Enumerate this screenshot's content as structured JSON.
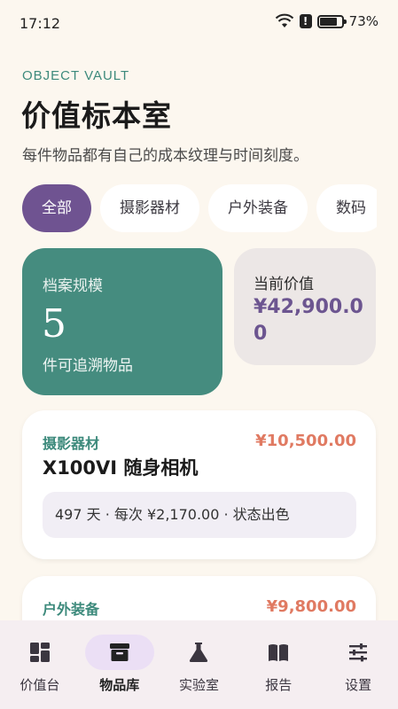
{
  "status_bar": {
    "time": "17:12",
    "battery": "73%",
    "battery_level": 0.73
  },
  "header": {
    "brand": "OBJECT VAULT",
    "title": "价值标本室",
    "subtitle": "每件物品都有自己的成本纹理与时间刻度。"
  },
  "filters": [
    {
      "label": "全部",
      "selected": true
    },
    {
      "label": "摄影器材",
      "selected": false
    },
    {
      "label": "户外装备",
      "selected": false
    },
    {
      "label": "数码",
      "selected": false
    }
  ],
  "stats": {
    "count_label": "档案规模",
    "count_value": "5",
    "count_caption": "件可追溯物品",
    "value_label": "当前价值",
    "value_amount": "¥42,900.00"
  },
  "items": [
    {
      "category": "摄影器材",
      "price": "¥10,500.00",
      "name": "X100VI 随身相机",
      "meta": "497 天 · 每次 ¥2,170.00 · 状态出色"
    },
    {
      "category": "户外装备",
      "price": "¥9,800.00"
    }
  ],
  "bottom_nav": [
    {
      "label": "价值台",
      "icon": "dashboard-icon",
      "active": false
    },
    {
      "label": "物品库",
      "icon": "archive-box-icon",
      "active": true
    },
    {
      "label": "实验室",
      "icon": "flask-icon",
      "active": false
    },
    {
      "label": "报告",
      "icon": "book-icon",
      "active": false
    },
    {
      "label": "设置",
      "icon": "sliders-icon",
      "active": false
    }
  ],
  "colors": {
    "accent_purple": "#6f5391",
    "accent_green": "#458c7f",
    "price_orange": "#e07a62",
    "background": "#fcf7ef"
  }
}
